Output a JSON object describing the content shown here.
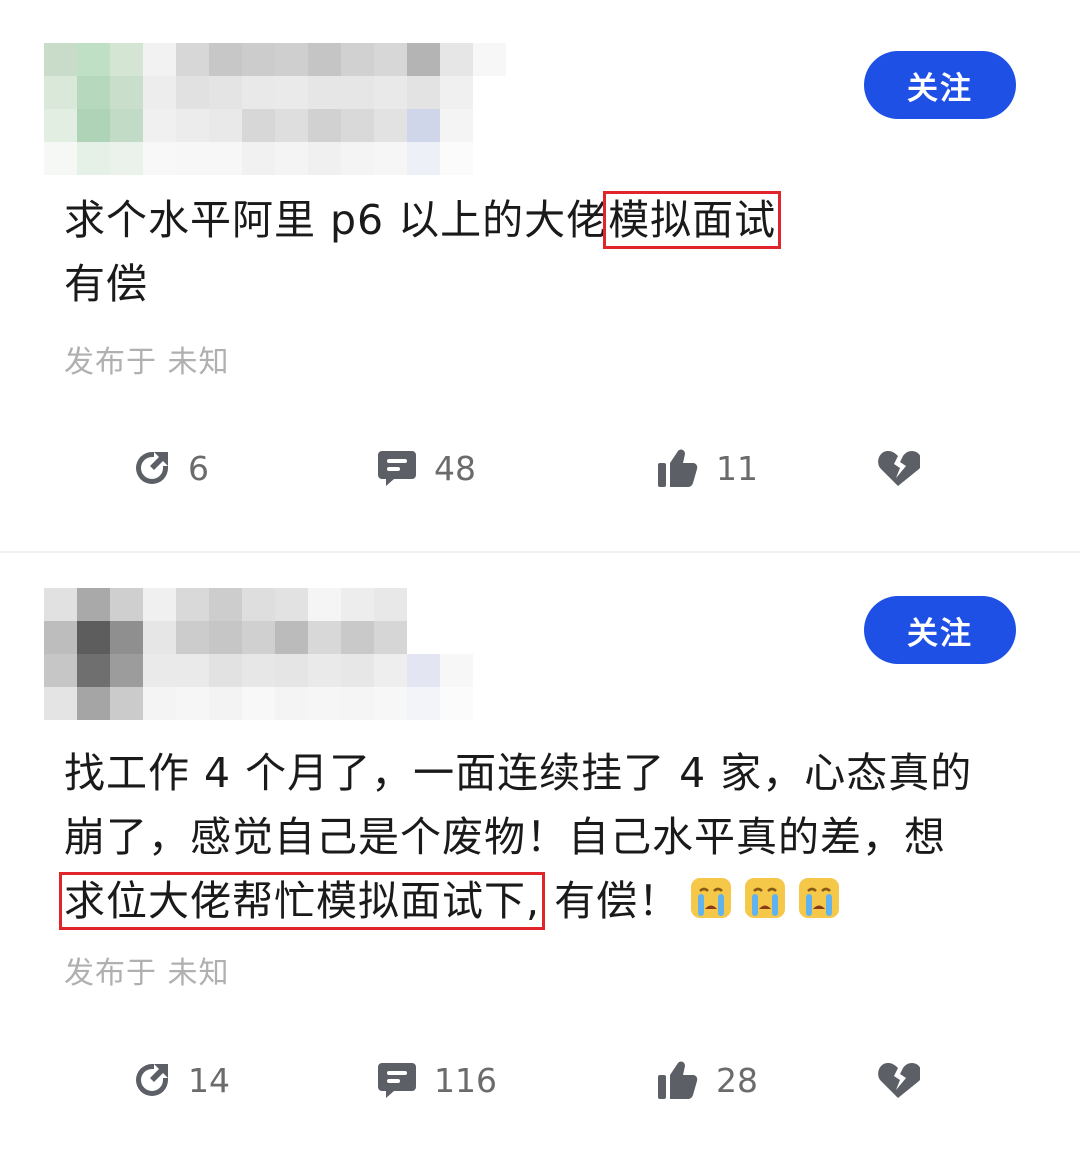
{
  "posts": [
    {
      "follow_label": "关注",
      "text_plain_1": "求个水平阿里 p6 以上的大佬",
      "text_highlight_1": "模拟面试",
      "text_line_2": "有偿",
      "published": "发布于 未知",
      "share_count": "6",
      "comment_count": "48",
      "like_count": "11"
    },
    {
      "follow_label": "关注",
      "text_line_1": "找工作 4 个月了，一面连续挂了 4 家，心态真的",
      "text_line_2": "崩了，感觉自己是个废物！自己水平真的差，想",
      "text_highlight_3": "求位大佬帮忙模拟面试下,",
      "text_plain_3": " 有偿！",
      "published": "发布于 未知",
      "share_count": "14",
      "comment_count": "116",
      "like_count": "28"
    }
  ],
  "icons": {
    "share": "share-arrow-icon",
    "comment": "comment-bubble-icon",
    "like": "thumbs-up-icon",
    "dislike": "broken-heart-icon",
    "emoji": "crying-face-emoji"
  },
  "colors": {
    "accent": "#1f50e6",
    "highlight_box": "#e0262b",
    "meta_text": "#b0b0b0",
    "icon": "#5c5f66"
  }
}
